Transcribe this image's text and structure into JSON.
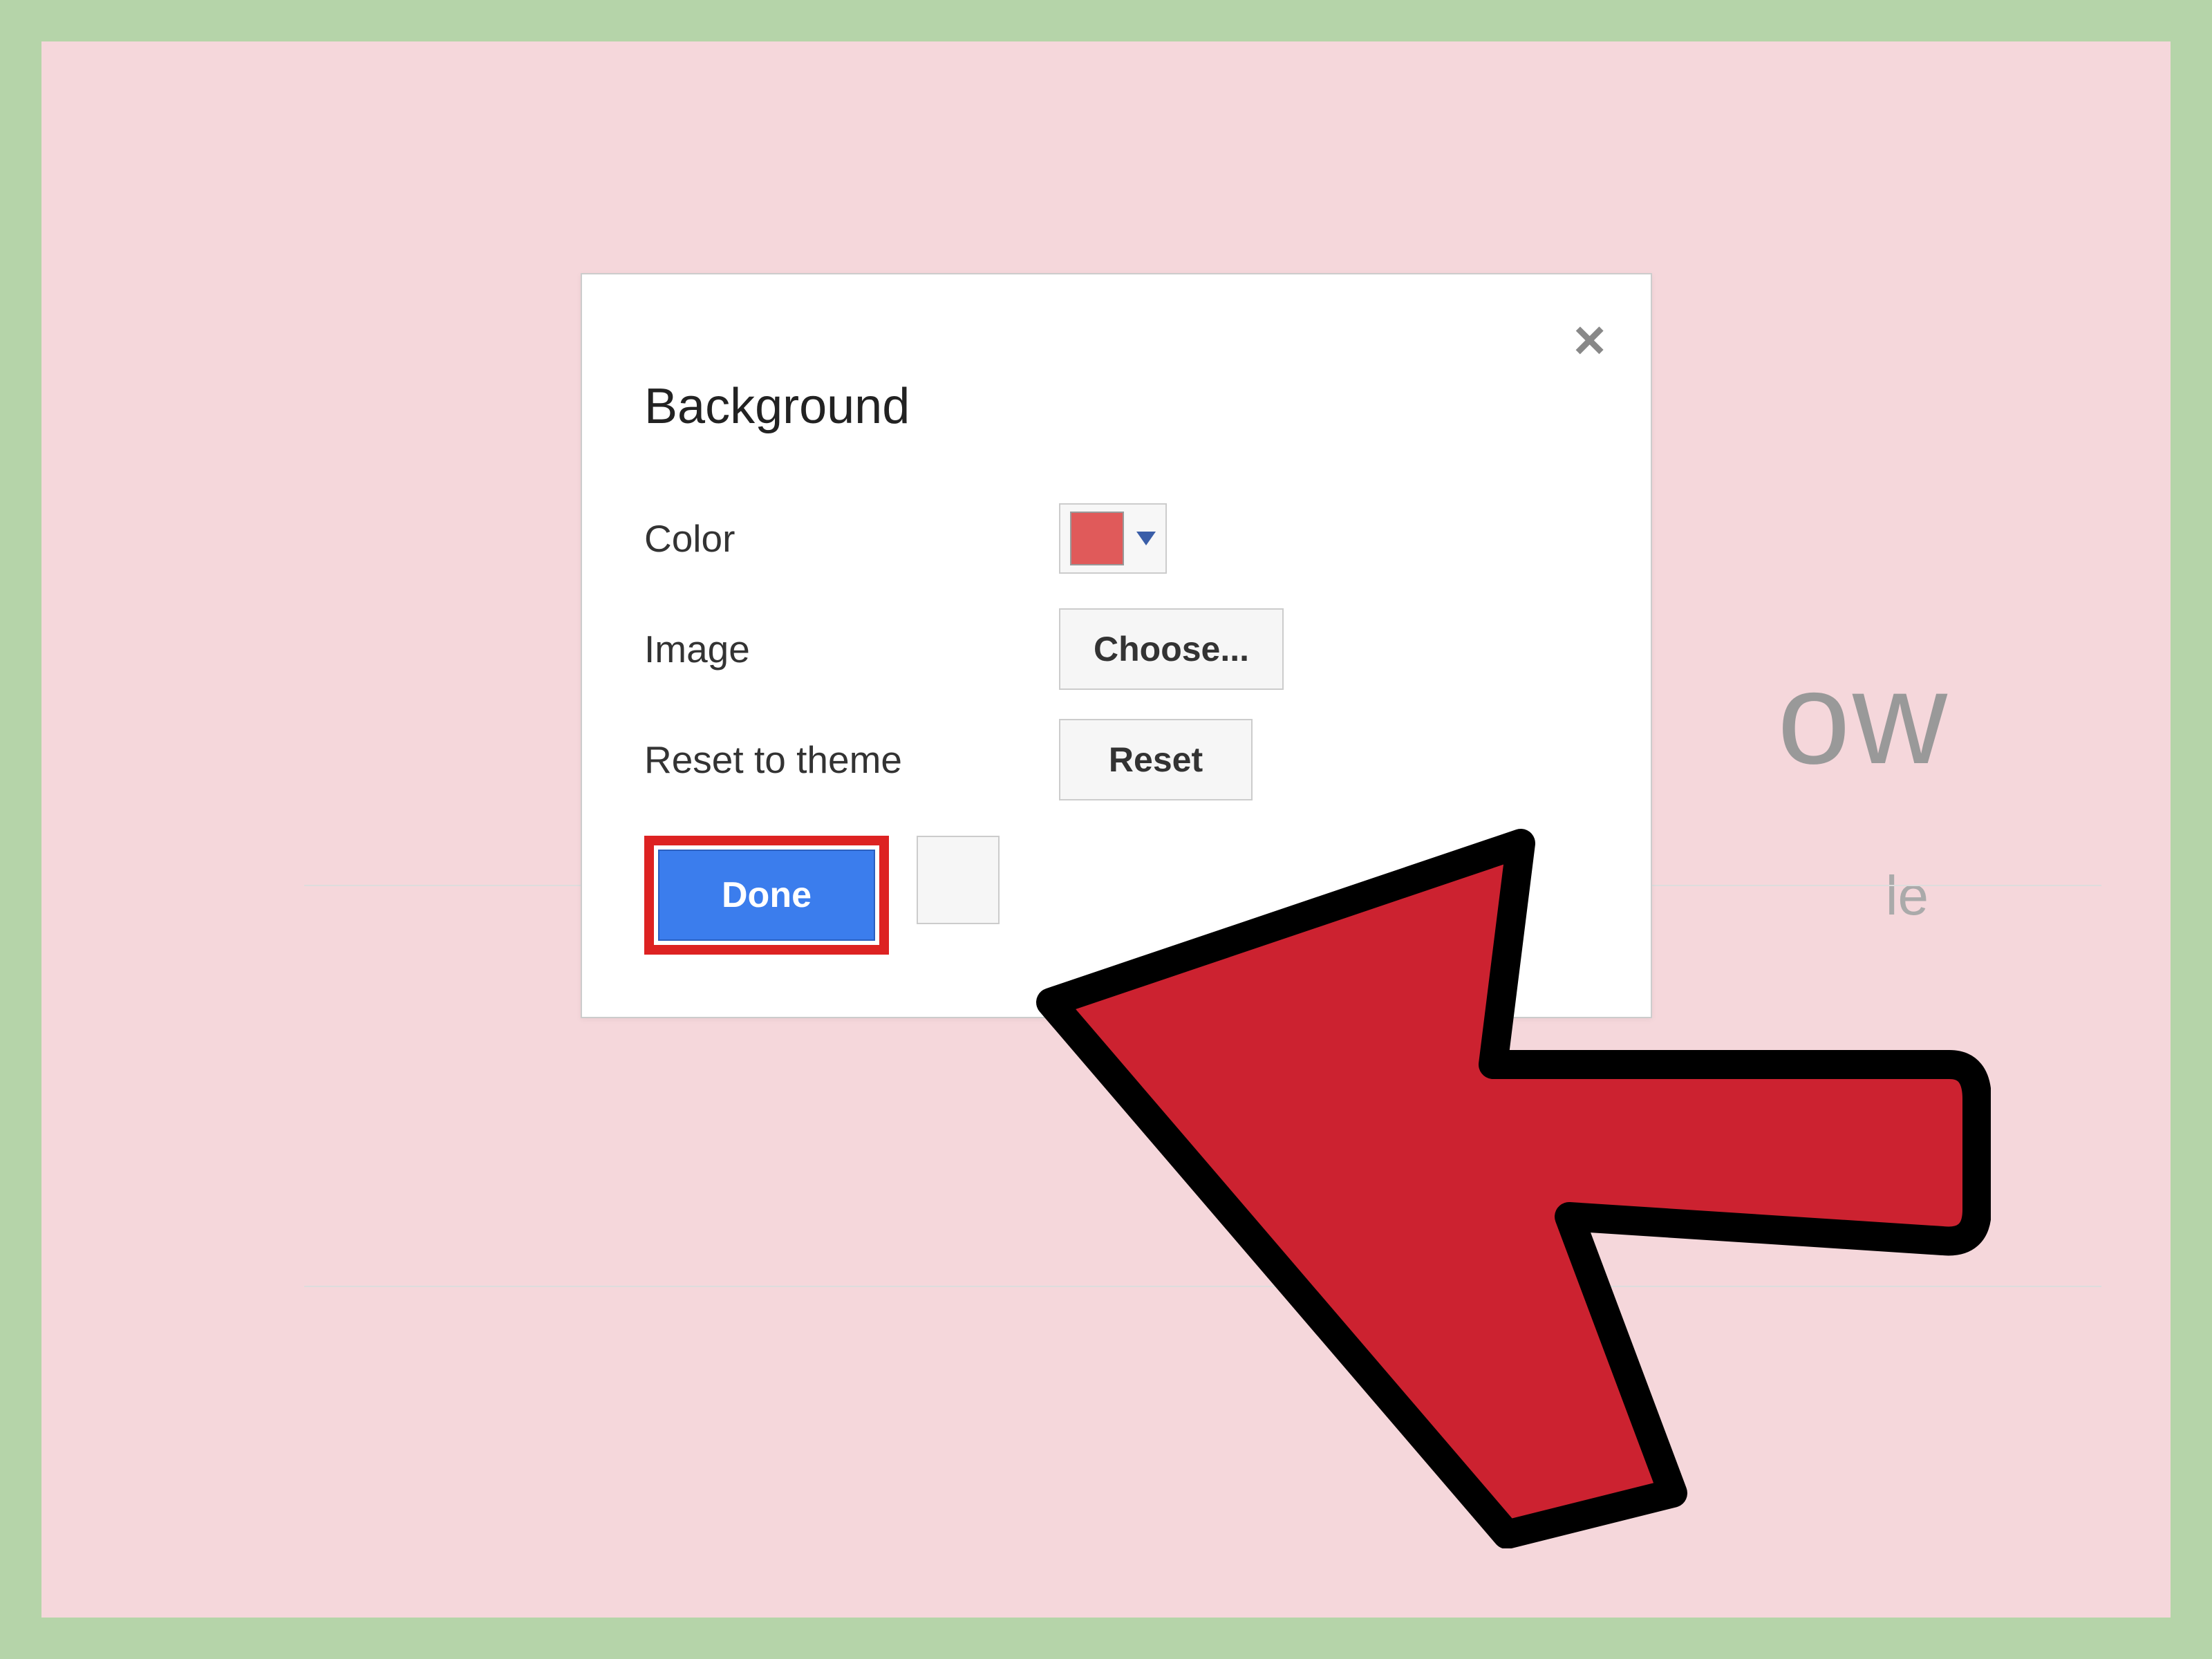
{
  "background": {
    "large_text_fragment": "ow",
    "subtitle_fragment": "le"
  },
  "dialog": {
    "title": "Background",
    "rows": {
      "color": {
        "label": "Color",
        "selected_color": "#e05a5a"
      },
      "image": {
        "label": "Image",
        "button": "Choose..."
      },
      "reset": {
        "label": "Reset to theme",
        "button": "Reset"
      }
    },
    "actions": {
      "primary": "Done"
    }
  },
  "colors": {
    "outer_frame": "#b5d4a9",
    "inner_bg": "#f5d7db",
    "highlight": "#d22",
    "primary_btn": "#3b7ded",
    "arrow": "#cc2230"
  }
}
